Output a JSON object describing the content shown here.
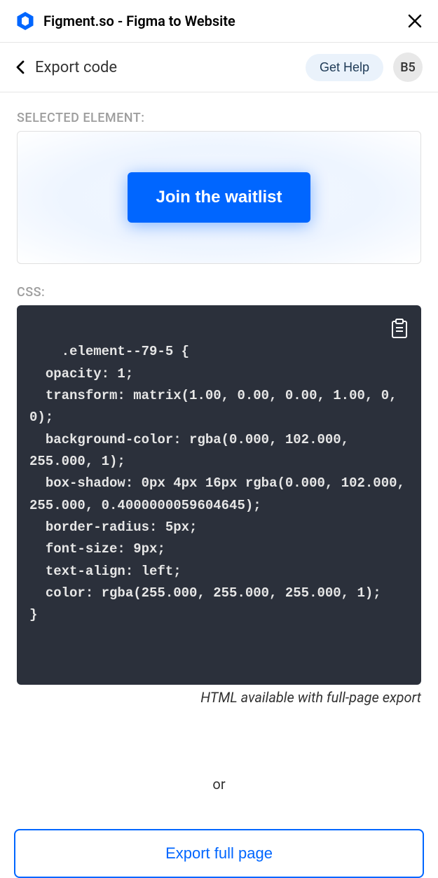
{
  "header": {
    "app_title": "Figment.so - Figma to Website"
  },
  "subheader": {
    "page_title": "Export code",
    "get_help_label": "Get Help",
    "avatar_initials": "B5"
  },
  "selected_element": {
    "label": "SELECTED ELEMENT:",
    "preview_button_text": "Join the waitlist"
  },
  "css_section": {
    "label": "CSS:",
    "code": ".element--79-5 {\n  opacity: 1;\n  transform: matrix(1.00, 0.00, 0.00, 1.00, 0, 0);\n  background-color: rgba(0.000, 102.000, 255.000, 1);\n  box-shadow: 0px 4px 16px rgba(0.000, 102.000, 255.000, 0.4000000059604645);\n  border-radius: 5px;\n  font-size: 9px;\n  text-align: left;\n  color: rgba(255.000, 255.000, 255.000, 1);\n}",
    "note": "HTML available with full-page export"
  },
  "footer": {
    "or_text": "or",
    "export_full_label": "Export full page"
  }
}
